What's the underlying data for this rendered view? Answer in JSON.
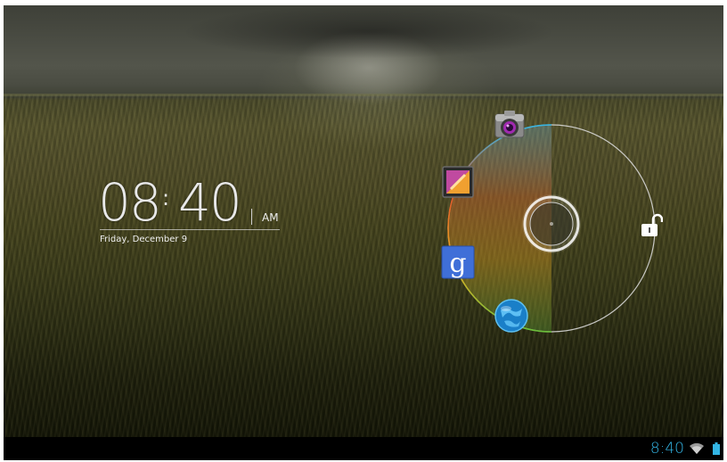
{
  "lock_screen": {
    "clock": {
      "hours": "08",
      "separator": ":",
      "minutes": "40",
      "ampm": "AM",
      "date": "Friday, December 9"
    },
    "unlock_targets": [
      {
        "name": "camera",
        "icon": "camera-icon"
      },
      {
        "name": "gallery",
        "icon": "gallery-icon"
      },
      {
        "name": "google-search",
        "icon": "google-g-icon",
        "glyph": "g"
      },
      {
        "name": "browser",
        "icon": "globe-icon"
      },
      {
        "name": "unlock",
        "icon": "unlock-padlock-icon"
      }
    ],
    "handle": {
      "icon": "ring-handle-icon"
    }
  },
  "status_bar": {
    "time": "8:40",
    "wifi": "wifi-icon",
    "battery": "battery-icon",
    "accent_color": "#33b5e5"
  },
  "colors": {
    "ring_stroke": "#d8d8d8",
    "ring_accent": "#33b5e5",
    "handle_glow": "#ffffff"
  }
}
